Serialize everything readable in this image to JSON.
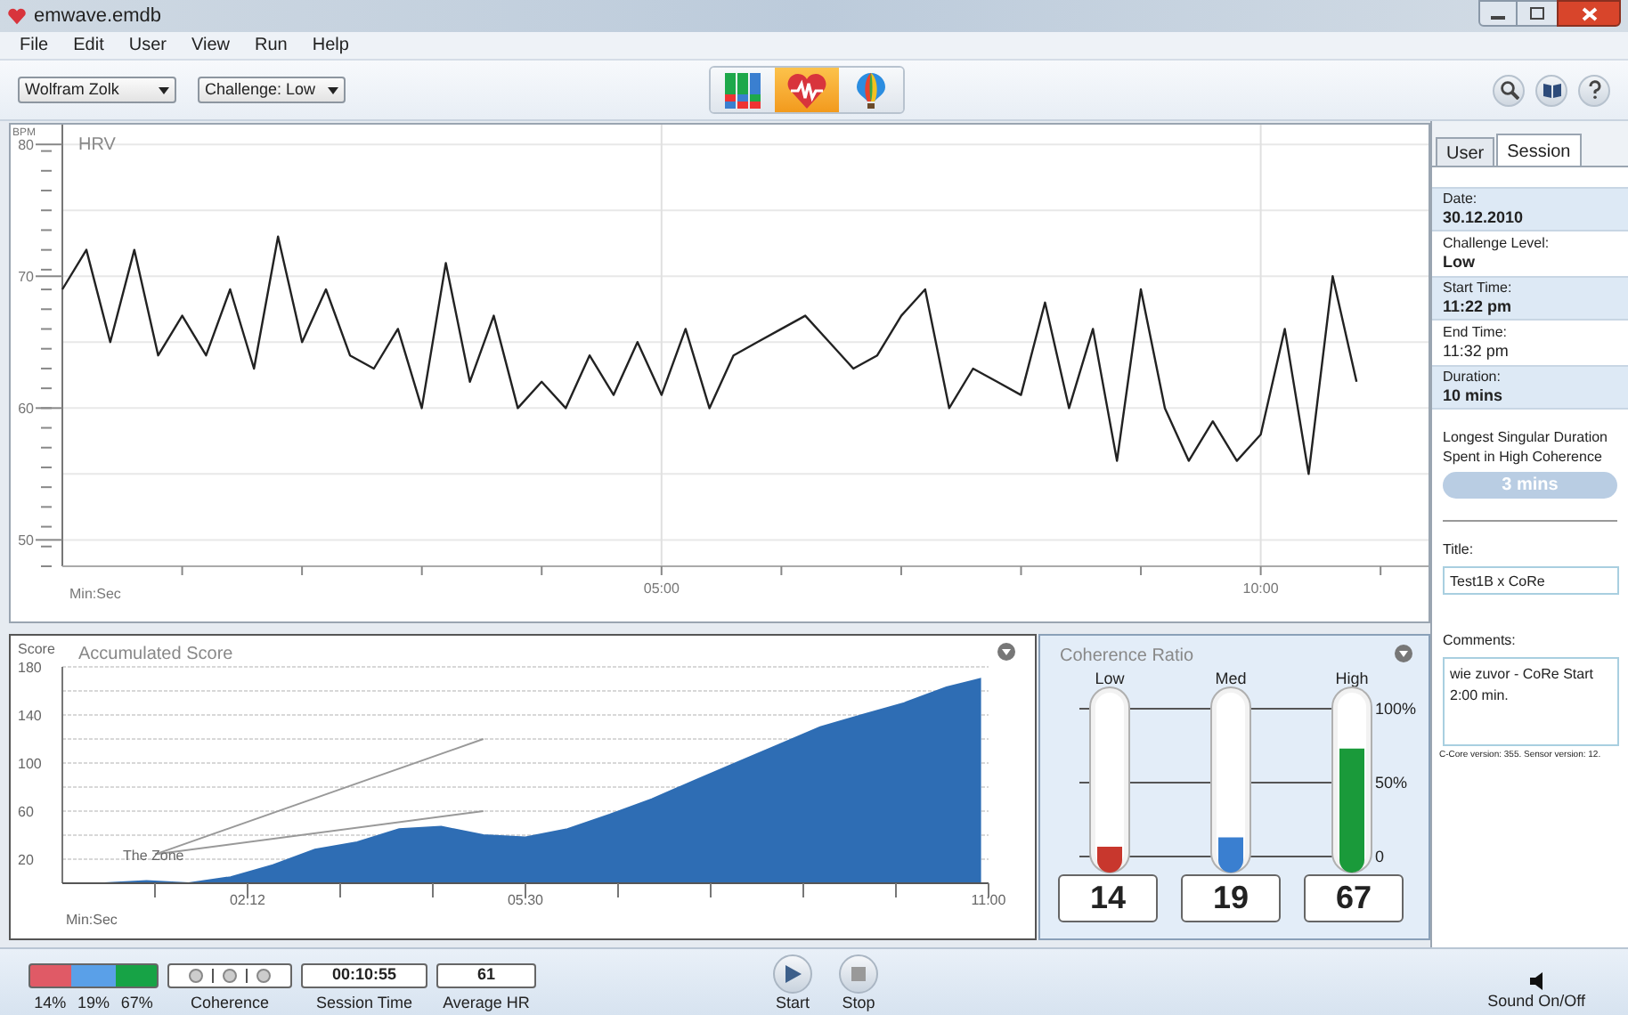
{
  "window": {
    "title": "emwave.emdb"
  },
  "menu": [
    "File",
    "Edit",
    "User",
    "View",
    "Run",
    "Help"
  ],
  "toolbar": {
    "user_select": "Wolfram Zolk",
    "challenge_select": "Challenge: Low",
    "views": [
      {
        "kind": "bars",
        "selected": false
      },
      {
        "kind": "heart",
        "selected": true
      },
      {
        "kind": "balloon",
        "selected": false
      }
    ]
  },
  "hrv": {
    "chart_data": {
      "type": "line",
      "title": "HRV",
      "xlabel": "Min:Sec",
      "ylabel": "BPM",
      "x": [
        0,
        0.2,
        0.4,
        0.6,
        0.8,
        1,
        1.2,
        1.4,
        1.6,
        1.8,
        2,
        2.2,
        2.4,
        2.6,
        2.8,
        3,
        3.2,
        3.4,
        3.6,
        3.8,
        4,
        4.2,
        4.4,
        4.6,
        4.8,
        5,
        5.2,
        5.4,
        5.6,
        5.8,
        6,
        6.2,
        6.4,
        6.6,
        6.8,
        7,
        7.2,
        7.4,
        7.6,
        7.8,
        8,
        8.2,
        8.4,
        8.6,
        8.8,
        9,
        9.2,
        9.4,
        9.6,
        9.8,
        10,
        10.2,
        10.4,
        10.6,
        10.8
      ],
      "series": [
        {
          "color": "#222222",
          "values": [
            69,
            72,
            65,
            72,
            64,
            67,
            64,
            69,
            63,
            73,
            65,
            69,
            64,
            63,
            66,
            60,
            71,
            62,
            67,
            60,
            62,
            60,
            64,
            61,
            65,
            61,
            66,
            60,
            64,
            65,
            66,
            67,
            65,
            63,
            64,
            67,
            69,
            60,
            63,
            62,
            61,
            68,
            60,
            66,
            56,
            69,
            60,
            56,
            59,
            56,
            58,
            66,
            55,
            70,
            62
          ]
        }
      ],
      "ylim": [
        48,
        81.5
      ],
      "xlim": [
        0,
        11.4
      ],
      "grid": true,
      "yticks": [
        50,
        60,
        70,
        80
      ],
      "xticks": [
        {
          "value": 5,
          "label": "05:00"
        },
        {
          "value": 10,
          "label": "10:00"
        }
      ]
    }
  },
  "score": {
    "chart_data": {
      "type": "area",
      "title": "Accumulated Score",
      "xlabel": "Min:Sec",
      "ylabel": "Score",
      "x": [
        0,
        0.5,
        1,
        1.5,
        2,
        2.5,
        3,
        3.5,
        4,
        4.5,
        5,
        5.5,
        6,
        6.5,
        7,
        7.5,
        8,
        8.5,
        9,
        9.5,
        10,
        10.5,
        10.9
      ],
      "series": [
        {
          "color": "#2e6db4",
          "values": [
            0,
            0,
            2,
            0,
            5,
            15,
            28,
            34,
            45,
            47,
            40,
            38,
            45,
            57,
            70,
            85,
            100,
            115,
            130,
            140,
            150,
            163,
            170
          ]
        }
      ],
      "ylim": [
        0,
        180
      ],
      "yticks": [
        20,
        60,
        100,
        140,
        180
      ],
      "xlim": [
        0,
        11
      ],
      "grid": true,
      "xticks": [
        {
          "value": 2.2,
          "label": "02:12"
        },
        {
          "value": 5.5,
          "label": "05:30"
        },
        {
          "value": 11,
          "label": "11:00"
        }
      ],
      "annotations": [
        "The Zone"
      ]
    }
  },
  "coherence_ratio": {
    "title": "Coherence Ratio",
    "scale": [
      "100%",
      "50%",
      "0"
    ],
    "tubes": [
      {
        "label": "Low",
        "level": 0.14,
        "value": "14",
        "color": "#c8372d"
      },
      {
        "label": "Med",
        "level": 0.19,
        "value": "19",
        "color": "#3a7fd0"
      },
      {
        "label": "High",
        "level": 0.67,
        "value": "67",
        "color": "#1a9a3a"
      }
    ]
  },
  "sidebar": {
    "tabs": [
      {
        "label": "User",
        "selected": false
      },
      {
        "label": "Session",
        "selected": true
      }
    ],
    "fields": [
      {
        "label": "Date:",
        "value": "30.12.2010",
        "bold": true
      },
      {
        "label": "Challenge Level:",
        "value": "Low",
        "bold": true
      },
      {
        "label": "Start Time:",
        "value": "11:22 pm",
        "bold": true
      },
      {
        "label": "End Time:",
        "value": "11:32 pm",
        "bold": false
      },
      {
        "label": "Duration:",
        "value": "10 mins",
        "bold": true
      }
    ],
    "longest_label": "Longest Singular Duration Spent in High Coherence",
    "longest_value": "3 mins",
    "title_label": "Title:",
    "title_value": "Test1B x CoRe",
    "comments_label": "Comments:",
    "comments_value": "wie zuvor - CoRe Start 2:00 min.",
    "version": "C-Core version: 355.  Sensor version: 12."
  },
  "status": {
    "segments": [
      {
        "label": "14%",
        "color": "#e05a66"
      },
      {
        "label": "19%",
        "color": "#5aa0e8"
      },
      {
        "label": "67%",
        "color": "#17a346"
      }
    ],
    "lights": [
      {
        "on": false
      },
      {
        "on": false
      },
      {
        "on": false
      }
    ],
    "lights_label": "Coherence",
    "session_time": "00:10:55",
    "session_time_label": "Session Time",
    "average_hr": "61",
    "average_hr_label": "Average HR",
    "start_label": "Start",
    "stop_label": "Stop",
    "sound_label": "Sound On/Off"
  }
}
